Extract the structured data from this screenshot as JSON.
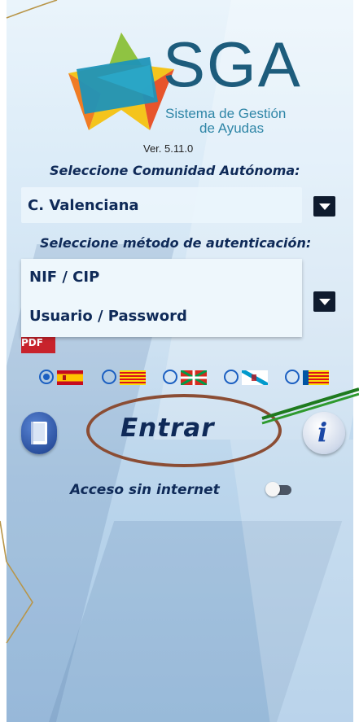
{
  "app": {
    "logo_text": "SGA",
    "logo_subtitle_line1": "Sistema de Gestión",
    "logo_subtitle_line2": "de Ayudas",
    "version": "Ver. 5.11.0"
  },
  "community": {
    "label": "Seleccione Comunidad Autónoma:",
    "selected": "C. Valenciana"
  },
  "auth": {
    "label": "Seleccione método de autenticación:",
    "options": [
      "NIF / CIP",
      "Usuario / Password"
    ]
  },
  "languages": {
    "selected_index": 0,
    "flags": [
      "spain-flag-icon",
      "catalonia-flag-icon",
      "basque-flag-icon",
      "galicia-flag-icon",
      "valencia-flag-icon"
    ]
  },
  "actions": {
    "enter_label": "Entrar",
    "manual_icon": "book-icon",
    "info_icon": "info-icon"
  },
  "offline": {
    "label": "Acceso sin internet",
    "enabled": false
  }
}
